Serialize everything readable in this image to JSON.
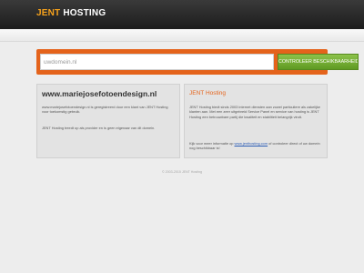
{
  "header": {
    "logo_accent": "JENT",
    "logo_rest": " HOSTING"
  },
  "search": {
    "value": "uwdomein.nl",
    "button_label": "CONTROLEER BESCHIKBAARHEID"
  },
  "left_panel": {
    "title": "www.mariejosefotoendesign.nl",
    "paragraph1": "www.mariejosefotoendesign.nl is geregistreerd door een klant van JENT Hosting voor toekomstig gebruik.",
    "paragraph2": "JENT Hosting treedt op als provider en is geen eigenaar van dit domein."
  },
  "right_panel": {
    "title": "JENT Hosting",
    "paragraph1": "JENT Hosting biedt sinds 2003 internet diensten aan zowel particuliere als zakelijke klanten aan. Met een zeer uitgebreid Service Panel en service van hosting is JENT Hosting een betrouwbare partij die kwaliteit en stabiliteit belangrijk vindt.",
    "paragraph2_before": "Kijk voor meer informatie op ",
    "paragraph2_link": "www.jenthosting.com",
    "paragraph2_after": " of controleer direct of uw domein nog beschikbaar is!"
  },
  "footer": {
    "copyright": "© 2003-2015 JENT Hosting"
  }
}
